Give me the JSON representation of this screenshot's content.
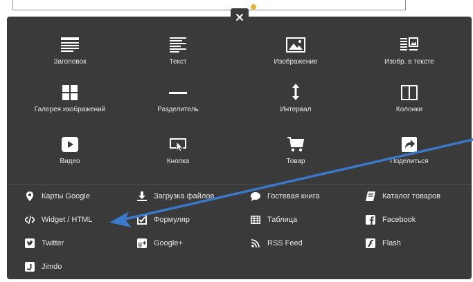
{
  "close_icon": "close-icon",
  "tiles": [
    {
      "label": "Заголовок",
      "icon": "heading-icon"
    },
    {
      "label": "Текст",
      "icon": "text-icon"
    },
    {
      "label": "Изображение",
      "icon": "image-icon"
    },
    {
      "label": "Изобр. в тексте",
      "icon": "image-in-text-icon"
    },
    {
      "label": "Галерея изображений",
      "icon": "gallery-icon"
    },
    {
      "label": "Разделитель",
      "icon": "divider-icon"
    },
    {
      "label": "Интервал",
      "icon": "spacing-icon"
    },
    {
      "label": "Колонки",
      "icon": "columns-icon"
    },
    {
      "label": "Видео",
      "icon": "video-icon"
    },
    {
      "label": "Кнопка",
      "icon": "button-icon"
    },
    {
      "label": "Товар",
      "icon": "cart-icon"
    },
    {
      "label": "Поделиться",
      "icon": "share-icon"
    }
  ],
  "small_items": [
    {
      "label": "Карты Google",
      "icon": "map-pin-icon"
    },
    {
      "label": "Загрузка файлов",
      "icon": "download-icon"
    },
    {
      "label": "Гостевая книга",
      "icon": "speech-bubble-icon"
    },
    {
      "label": "Каталог товаров",
      "icon": "catalog-icon"
    },
    {
      "label": "Widget / HTML",
      "icon": "code-icon"
    },
    {
      "label": "Формуляр",
      "icon": "checkbox-form-icon"
    },
    {
      "label": "Таблица",
      "icon": "table-icon"
    },
    {
      "label": "Facebook",
      "icon": "facebook-icon"
    },
    {
      "label": "Twitter",
      "icon": "twitter-icon"
    },
    {
      "label": "Google+",
      "icon": "google-plus-icon"
    },
    {
      "label": "RSS Feed",
      "icon": "rss-icon"
    },
    {
      "label": "Flash",
      "icon": "flash-icon"
    },
    {
      "label": "Jimdo",
      "icon": "jimdo-icon"
    }
  ],
  "annotation": {
    "icon": "pointer-arrow-icon",
    "color": "#3a78c9"
  },
  "colors": {
    "panel": "#3a3a3a",
    "text": "#e8e8e8",
    "icon": "#ffffff"
  }
}
